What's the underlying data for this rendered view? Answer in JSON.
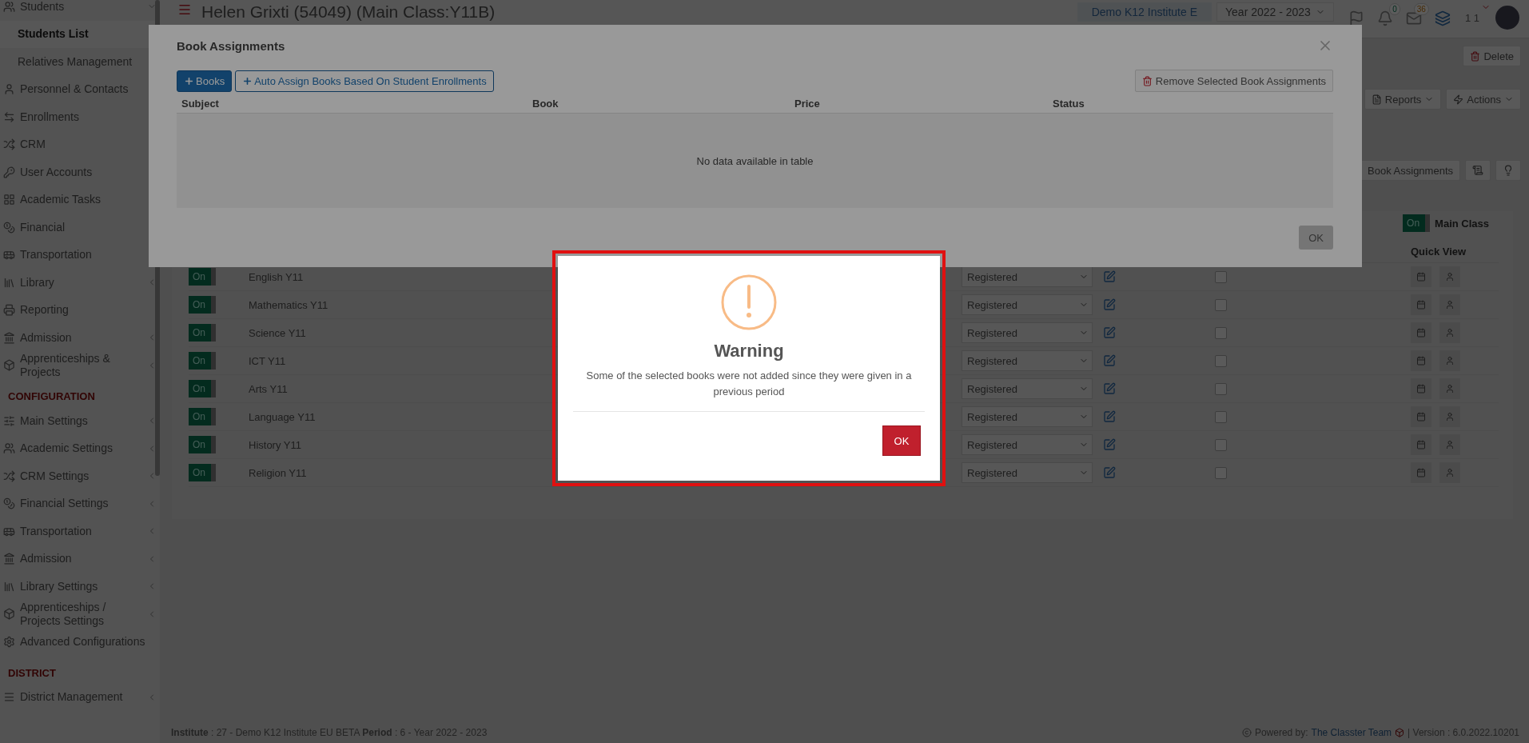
{
  "sidebar": {
    "items": [
      {
        "kind": "item",
        "label": "Students",
        "submenu": true,
        "expanded": true,
        "children": [
          {
            "label": "Students List",
            "selected": true
          },
          {
            "label": "Relatives Management",
            "selected": false
          }
        ]
      },
      {
        "kind": "item",
        "label": "Personnel & Contacts",
        "submenu": false
      },
      {
        "kind": "item",
        "label": "Enrollments",
        "submenu": false
      },
      {
        "kind": "item",
        "label": "CRM",
        "submenu": false
      },
      {
        "kind": "item",
        "label": "User Accounts",
        "submenu": false
      },
      {
        "kind": "item",
        "label": "Academic Tasks",
        "submenu": false
      },
      {
        "kind": "item",
        "label": "Financial",
        "submenu": false
      },
      {
        "kind": "item",
        "label": "Transportation",
        "submenu": false
      },
      {
        "kind": "item",
        "label": "Library",
        "submenu": true
      },
      {
        "kind": "item",
        "label": "Reporting",
        "submenu": false
      },
      {
        "kind": "item",
        "label": "Admission",
        "submenu": true
      },
      {
        "kind": "item",
        "label": "Apprenticeships & Projects",
        "submenu": true
      },
      {
        "kind": "heading",
        "label": "CONFIGURATION"
      },
      {
        "kind": "item",
        "label": "Main Settings",
        "submenu": true
      },
      {
        "kind": "item",
        "label": "Academic Settings",
        "submenu": true
      },
      {
        "kind": "item",
        "label": "CRM Settings",
        "submenu": true
      },
      {
        "kind": "item",
        "label": "Financial Settings",
        "submenu": true
      },
      {
        "kind": "item",
        "label": "Transportation",
        "submenu": true
      },
      {
        "kind": "item",
        "label": "Admission",
        "submenu": true
      },
      {
        "kind": "item",
        "label": "Library Settings",
        "submenu": true
      },
      {
        "kind": "item",
        "label": "Apprenticeships / Projects Settings",
        "submenu": true
      },
      {
        "kind": "item",
        "label": "Advanced Configurations",
        "submenu": false
      },
      {
        "kind": "heading",
        "label": "DISTRICT"
      },
      {
        "kind": "item",
        "label": "District Management",
        "submenu": true
      }
    ]
  },
  "header": {
    "title": "Helen Grixti (54049) (Main Class:Y11B)",
    "institute": "Demo K12 Institute E",
    "year": "Year 2022 - 2023",
    "notifications": "0",
    "messages": "36",
    "user": "1 1"
  },
  "toolbar": {
    "delete": "Delete",
    "reports": "Reports",
    "actions": "Actions",
    "book_assignments": "Book Assignments"
  },
  "main_class": {
    "toggle_label": "On",
    "on": true,
    "label": "Main Class"
  },
  "table": {
    "quick_view": "Quick View",
    "rows": [
      {
        "toggle_label": "On",
        "on": true,
        "subject": "English Y11",
        "status": "Registered",
        "checked": false
      },
      {
        "toggle_label": "On",
        "on": true,
        "subject": "Mathematics Y11",
        "status": "Registered",
        "checked": false
      },
      {
        "toggle_label": "On",
        "on": true,
        "subject": "Science Y11",
        "status": "Registered",
        "checked": false
      },
      {
        "toggle_label": "On",
        "on": true,
        "subject": "ICT Y11",
        "status": "Registered",
        "checked": false
      },
      {
        "toggle_label": "On",
        "on": true,
        "subject": "Arts Y11",
        "status": "Registered",
        "checked": false
      },
      {
        "toggle_label": "On",
        "on": true,
        "subject": "Language Y11",
        "status": "Registered",
        "checked": false
      },
      {
        "toggle_label": "On",
        "on": true,
        "subject": "History Y11",
        "status": "Registered",
        "checked": false
      },
      {
        "toggle_label": "On",
        "on": true,
        "subject": "Religion Y11",
        "status": "Registered",
        "checked": false
      }
    ]
  },
  "footer": {
    "info": "**Institute** : 27 - Demo K12 Institute EU BETA **Period** : 6 - Year 2022 - 2023",
    "powered": "Powered by:",
    "team": "The Classter Team",
    "version": "| Version : 6.0.2022.10201"
  },
  "book_dialog": {
    "title": "Book Assignments",
    "add_button": "Books",
    "auto_button": "Auto Assign Books Based On Student Enrollments",
    "remove_button": "Remove Selected Book Assignments",
    "columns": [
      "Subject",
      "Book",
      "Price",
      "Status"
    ],
    "empty": "No data available in table",
    "ok": {
      "label": "OK",
      "disabled": true
    }
  },
  "warning": {
    "title": "Warning",
    "message": "Some of the selected books were not added since they were given in a previous period",
    "ok": "OK"
  }
}
